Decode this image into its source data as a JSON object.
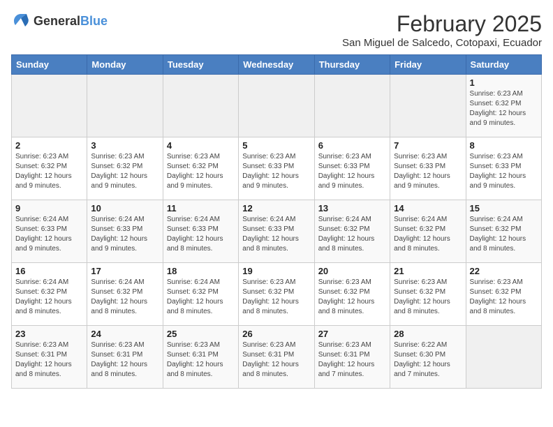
{
  "logo": {
    "general": "General",
    "blue": "Blue"
  },
  "header": {
    "month": "February 2025",
    "location": "San Miguel de Salcedo, Cotopaxi, Ecuador"
  },
  "weekdays": [
    "Sunday",
    "Monday",
    "Tuesday",
    "Wednesday",
    "Thursday",
    "Friday",
    "Saturday"
  ],
  "weeks": [
    [
      {
        "day": "",
        "info": ""
      },
      {
        "day": "",
        "info": ""
      },
      {
        "day": "",
        "info": ""
      },
      {
        "day": "",
        "info": ""
      },
      {
        "day": "",
        "info": ""
      },
      {
        "day": "",
        "info": ""
      },
      {
        "day": "1",
        "info": "Sunrise: 6:23 AM\nSunset: 6:32 PM\nDaylight: 12 hours and 9 minutes."
      }
    ],
    [
      {
        "day": "2",
        "info": "Sunrise: 6:23 AM\nSunset: 6:32 PM\nDaylight: 12 hours and 9 minutes."
      },
      {
        "day": "3",
        "info": "Sunrise: 6:23 AM\nSunset: 6:32 PM\nDaylight: 12 hours and 9 minutes."
      },
      {
        "day": "4",
        "info": "Sunrise: 6:23 AM\nSunset: 6:32 PM\nDaylight: 12 hours and 9 minutes."
      },
      {
        "day": "5",
        "info": "Sunrise: 6:23 AM\nSunset: 6:33 PM\nDaylight: 12 hours and 9 minutes."
      },
      {
        "day": "6",
        "info": "Sunrise: 6:23 AM\nSunset: 6:33 PM\nDaylight: 12 hours and 9 minutes."
      },
      {
        "day": "7",
        "info": "Sunrise: 6:23 AM\nSunset: 6:33 PM\nDaylight: 12 hours and 9 minutes."
      },
      {
        "day": "8",
        "info": "Sunrise: 6:23 AM\nSunset: 6:33 PM\nDaylight: 12 hours and 9 minutes."
      }
    ],
    [
      {
        "day": "9",
        "info": "Sunrise: 6:24 AM\nSunset: 6:33 PM\nDaylight: 12 hours and 9 minutes."
      },
      {
        "day": "10",
        "info": "Sunrise: 6:24 AM\nSunset: 6:33 PM\nDaylight: 12 hours and 9 minutes."
      },
      {
        "day": "11",
        "info": "Sunrise: 6:24 AM\nSunset: 6:33 PM\nDaylight: 12 hours and 8 minutes."
      },
      {
        "day": "12",
        "info": "Sunrise: 6:24 AM\nSunset: 6:33 PM\nDaylight: 12 hours and 8 minutes."
      },
      {
        "day": "13",
        "info": "Sunrise: 6:24 AM\nSunset: 6:32 PM\nDaylight: 12 hours and 8 minutes."
      },
      {
        "day": "14",
        "info": "Sunrise: 6:24 AM\nSunset: 6:32 PM\nDaylight: 12 hours and 8 minutes."
      },
      {
        "day": "15",
        "info": "Sunrise: 6:24 AM\nSunset: 6:32 PM\nDaylight: 12 hours and 8 minutes."
      }
    ],
    [
      {
        "day": "16",
        "info": "Sunrise: 6:24 AM\nSunset: 6:32 PM\nDaylight: 12 hours and 8 minutes."
      },
      {
        "day": "17",
        "info": "Sunrise: 6:24 AM\nSunset: 6:32 PM\nDaylight: 12 hours and 8 minutes."
      },
      {
        "day": "18",
        "info": "Sunrise: 6:24 AM\nSunset: 6:32 PM\nDaylight: 12 hours and 8 minutes."
      },
      {
        "day": "19",
        "info": "Sunrise: 6:23 AM\nSunset: 6:32 PM\nDaylight: 12 hours and 8 minutes."
      },
      {
        "day": "20",
        "info": "Sunrise: 6:23 AM\nSunset: 6:32 PM\nDaylight: 12 hours and 8 minutes."
      },
      {
        "day": "21",
        "info": "Sunrise: 6:23 AM\nSunset: 6:32 PM\nDaylight: 12 hours and 8 minutes."
      },
      {
        "day": "22",
        "info": "Sunrise: 6:23 AM\nSunset: 6:32 PM\nDaylight: 12 hours and 8 minutes."
      }
    ],
    [
      {
        "day": "23",
        "info": "Sunrise: 6:23 AM\nSunset: 6:31 PM\nDaylight: 12 hours and 8 minutes."
      },
      {
        "day": "24",
        "info": "Sunrise: 6:23 AM\nSunset: 6:31 PM\nDaylight: 12 hours and 8 minutes."
      },
      {
        "day": "25",
        "info": "Sunrise: 6:23 AM\nSunset: 6:31 PM\nDaylight: 12 hours and 8 minutes."
      },
      {
        "day": "26",
        "info": "Sunrise: 6:23 AM\nSunset: 6:31 PM\nDaylight: 12 hours and 8 minutes."
      },
      {
        "day": "27",
        "info": "Sunrise: 6:23 AM\nSunset: 6:31 PM\nDaylight: 12 hours and 7 minutes."
      },
      {
        "day": "28",
        "info": "Sunrise: 6:22 AM\nSunset: 6:30 PM\nDaylight: 12 hours and 7 minutes."
      },
      {
        "day": "",
        "info": ""
      }
    ]
  ]
}
